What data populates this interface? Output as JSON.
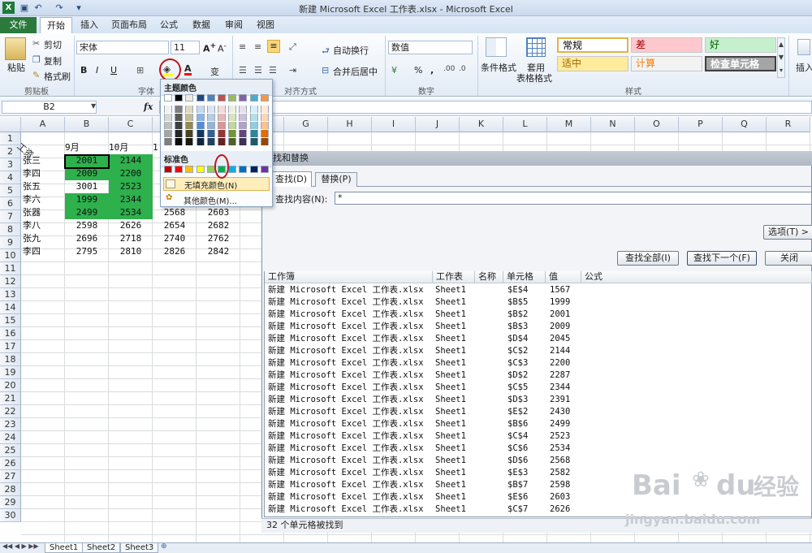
{
  "window": {
    "title": "新建 Microsoft Excel 工作表.xlsx - Microsoft Excel"
  },
  "tabs": [
    "文件",
    "开始",
    "插入",
    "页面布局",
    "公式",
    "数据",
    "审阅",
    "视图"
  ],
  "ribbon": {
    "clipboard": {
      "paste": "粘贴",
      "cut": "剪切",
      "copy": "复制",
      "format_painter": "格式刷",
      "group": "剪贴板"
    },
    "font": {
      "name": "宋体",
      "size": "11",
      "bold": "B",
      "italic": "I",
      "underline": "U",
      "group": "字体",
      "wen": "变"
    },
    "alignment": {
      "wrap": "自动换行",
      "merge": "合并后居中",
      "group": "对齐方式"
    },
    "number": {
      "format": "数值",
      "percent": "%",
      "comma": ",",
      "group": "数字"
    },
    "styles_group": {
      "cond_format": "条件格式",
      "table_format": "套用",
      "table_format2": "表格格式",
      "group": "样式"
    },
    "styles": [
      {
        "label": "常规",
        "bg": "#ffffff",
        "color": "#000000"
      },
      {
        "label": "差",
        "bg": "#ffc7ce",
        "color": "#9c0006"
      },
      {
        "label": "好",
        "bg": "#c6efce",
        "color": "#006100"
      },
      {
        "label": "适中",
        "bg": "#ffeb9c",
        "color": "#9c6500"
      },
      {
        "label": "计算",
        "bg": "#f2f2f2",
        "color": "#fa7d00"
      },
      {
        "label": "检查单元格",
        "bg": "#a5a5a5",
        "color": "#ffffff"
      }
    ],
    "insert": "插入"
  },
  "formula_bar": {
    "name_box": "B2",
    "fx": "fx"
  },
  "columns": [
    "A",
    "B",
    "C",
    "D",
    "E",
    "F",
    "G",
    "H",
    "I",
    "J",
    "K",
    "L",
    "M",
    "N",
    "O",
    "P",
    "Q",
    "R"
  ],
  "rows": [
    "1",
    "2",
    "3",
    "4",
    "5",
    "6",
    "7",
    "8",
    "9",
    "10",
    "11",
    "12",
    "13",
    "14",
    "15",
    "16",
    "17",
    "18",
    "19",
    "20",
    "21",
    "22",
    "23",
    "24",
    "25",
    "26",
    "27",
    "28",
    "29",
    "30"
  ],
  "sheet": {
    "a1": "工资",
    "headers": [
      "9月",
      "10月",
      "1"
    ],
    "names": [
      "张三",
      "李四",
      "张五",
      "李六",
      "张器",
      "李八",
      "张九",
      "李四"
    ],
    "b": [
      "2001",
      "2009",
      "3001",
      "1999",
      "2499",
      "2598",
      "2696",
      "2795"
    ],
    "c": [
      "2144",
      "2200",
      "2523",
      "2344",
      "2534",
      "2626",
      "2718",
      "2810"
    ],
    "d": [
      "",
      "",
      "",
      "",
      "2568",
      "2654",
      "2740",
      "2826"
    ],
    "e": [
      "",
      "",
      "",
      "",
      "2603",
      "2682",
      "2762",
      "2842"
    ]
  },
  "sheet_tabs": [
    "Sheet1",
    "Sheet2",
    "Sheet3"
  ],
  "palette": {
    "theme_title": "主题颜色",
    "standard_title": "标准色",
    "no_fill": "无填充颜色(N)",
    "more_colors": "其他颜色(M)...",
    "theme_top": [
      "#ffffff",
      "#000000",
      "#eeece1",
      "#1f497d",
      "#4f81bd",
      "#c0504d",
      "#9bbb59",
      "#8064a2",
      "#4bacc6",
      "#f79646"
    ],
    "theme_shades": [
      [
        "#f2f2f2",
        "#7f7f7f",
        "#ddd9c3",
        "#c6d9f0",
        "#dbe5f1",
        "#f2dcdb",
        "#ebf1dd",
        "#e5e0ec",
        "#dbeef3",
        "#fdeada"
      ],
      [
        "#d8d8d8",
        "#595959",
        "#c4bd97",
        "#8db3e2",
        "#b8cce4",
        "#e5b9b7",
        "#d7e3bc",
        "#ccc1d9",
        "#b7dde8",
        "#fbd5b5"
      ],
      [
        "#bfbfbf",
        "#3f3f3f",
        "#938953",
        "#548dd4",
        "#95b3d7",
        "#d99694",
        "#c3d69b",
        "#b2a2c7",
        "#92cddc",
        "#fac08f"
      ],
      [
        "#a5a5a5",
        "#262626",
        "#494429",
        "#17365d",
        "#366092",
        "#953734",
        "#76923c",
        "#5f497a",
        "#31859b",
        "#e36c09"
      ],
      [
        "#7f7f7f",
        "#0c0c0c",
        "#1d1b10",
        "#0f243e",
        "#244061",
        "#632423",
        "#4f6128",
        "#3f3151",
        "#205867",
        "#974806"
      ]
    ],
    "standard": [
      "#c00000",
      "#ff0000",
      "#ffc000",
      "#ffff00",
      "#92d050",
      "#00b050",
      "#00b0f0",
      "#0070c0",
      "#002060",
      "#7030a0"
    ]
  },
  "find_dialog": {
    "title": "找和替换",
    "tab_find": "查找(D)",
    "tab_replace": "替换(P)",
    "find_label": "查找内容(N):",
    "find_value": "*",
    "options_btn": "选项(T) >",
    "find_all": "查找全部(I)",
    "find_next": "查找下一个(F)",
    "close": "关闭",
    "columns": [
      "工作簿",
      "工作表",
      "名称",
      "单元格",
      "值",
      "公式"
    ],
    "results": [
      {
        "book": "新建 Microsoft Excel 工作表.xlsx",
        "sheet": "Sheet1",
        "cell": "$E$4",
        "value": "1567"
      },
      {
        "book": "新建 Microsoft Excel 工作表.xlsx",
        "sheet": "Sheet1",
        "cell": "$B$5",
        "value": "1999"
      },
      {
        "book": "新建 Microsoft Excel 工作表.xlsx",
        "sheet": "Sheet1",
        "cell": "$B$2",
        "value": "2001"
      },
      {
        "book": "新建 Microsoft Excel 工作表.xlsx",
        "sheet": "Sheet1",
        "cell": "$B$3",
        "value": "2009"
      },
      {
        "book": "新建 Microsoft Excel 工作表.xlsx",
        "sheet": "Sheet1",
        "cell": "$D$4",
        "value": "2045"
      },
      {
        "book": "新建 Microsoft Excel 工作表.xlsx",
        "sheet": "Sheet1",
        "cell": "$C$2",
        "value": "2144"
      },
      {
        "book": "新建 Microsoft Excel 工作表.xlsx",
        "sheet": "Sheet1",
        "cell": "$C$3",
        "value": "2200"
      },
      {
        "book": "新建 Microsoft Excel 工作表.xlsx",
        "sheet": "Sheet1",
        "cell": "$D$2",
        "value": "2287"
      },
      {
        "book": "新建 Microsoft Excel 工作表.xlsx",
        "sheet": "Sheet1",
        "cell": "$C$5",
        "value": "2344"
      },
      {
        "book": "新建 Microsoft Excel 工作表.xlsx",
        "sheet": "Sheet1",
        "cell": "$D$3",
        "value": "2391"
      },
      {
        "book": "新建 Microsoft Excel 工作表.xlsx",
        "sheet": "Sheet1",
        "cell": "$E$2",
        "value": "2430"
      },
      {
        "book": "新建 Microsoft Excel 工作表.xlsx",
        "sheet": "Sheet1",
        "cell": "$B$6",
        "value": "2499"
      },
      {
        "book": "新建 Microsoft Excel 工作表.xlsx",
        "sheet": "Sheet1",
        "cell": "$C$4",
        "value": "2523"
      },
      {
        "book": "新建 Microsoft Excel 工作表.xlsx",
        "sheet": "Sheet1",
        "cell": "$C$6",
        "value": "2534"
      },
      {
        "book": "新建 Microsoft Excel 工作表.xlsx",
        "sheet": "Sheet1",
        "cell": "$D$6",
        "value": "2568"
      },
      {
        "book": "新建 Microsoft Excel 工作表.xlsx",
        "sheet": "Sheet1",
        "cell": "$E$3",
        "value": "2582"
      },
      {
        "book": "新建 Microsoft Excel 工作表.xlsx",
        "sheet": "Sheet1",
        "cell": "$B$7",
        "value": "2598"
      },
      {
        "book": "新建 Microsoft Excel 工作表.xlsx",
        "sheet": "Sheet1",
        "cell": "$E$6",
        "value": "2603"
      },
      {
        "book": "新建 Microsoft Excel 工作表.xlsx",
        "sheet": "Sheet1",
        "cell": "$C$7",
        "value": "2626"
      }
    ],
    "status": "32 个单元格被找到"
  },
  "watermark": {
    "brand": "Bai",
    "brand2": "du",
    "cn": "经验",
    "url": "jingyan.baidu.com"
  }
}
